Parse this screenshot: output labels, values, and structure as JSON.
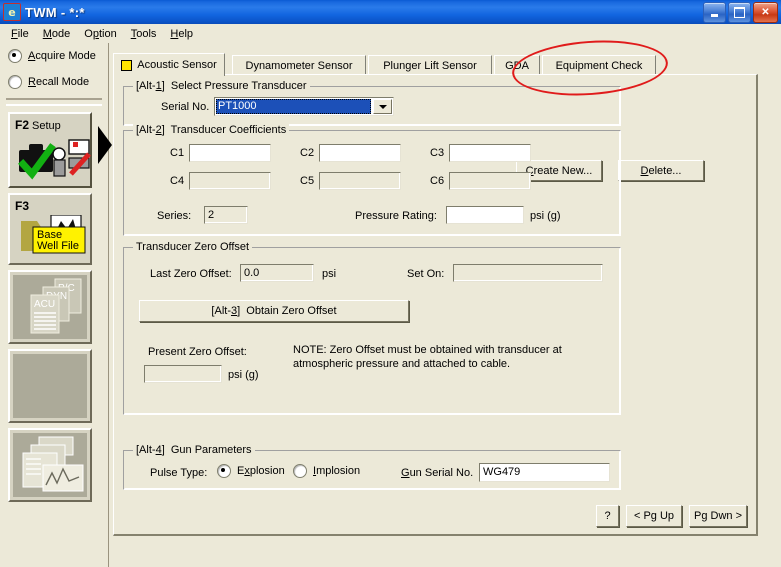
{
  "window": {
    "title": "TWM  -  *:*",
    "icon": "app-icon",
    "minimize": "_",
    "maximize": "□",
    "close": "✕"
  },
  "menubar": {
    "items": [
      {
        "label": "File",
        "accel": "F"
      },
      {
        "label": "Mode",
        "accel": "M"
      },
      {
        "label": "Option",
        "accel": "p"
      },
      {
        "label": "Tools",
        "accel": "T"
      },
      {
        "label": "Help",
        "accel": "H"
      }
    ]
  },
  "sidebar": {
    "modes": [
      {
        "label": "Acquire Mode",
        "accel": "A",
        "selected": true
      },
      {
        "label": "Recall Mode",
        "accel": "R",
        "selected": false
      }
    ],
    "buttons": [
      {
        "key": "F2",
        "label": "Setup",
        "art": "toolbox-check-icon",
        "enabled": true
      },
      {
        "key": "F3",
        "label": "Base Well File",
        "art": "yellow-folder-icon",
        "enabled": true
      },
      {
        "key": "",
        "label": "",
        "art": "document-stack-icon",
        "enabled": false,
        "doc_tags": [
          "P/C",
          "DYN",
          "ACU"
        ]
      },
      {
        "key": "",
        "label": "",
        "art": "blank-icon",
        "enabled": false
      },
      {
        "key": "",
        "label": "",
        "art": "report-chart-icon",
        "enabled": false
      }
    ]
  },
  "tabs": [
    {
      "label": "Acoustic Sensor",
      "active": true,
      "icon": "yellow-square-icon"
    },
    {
      "label": "Dynamometer Sensor",
      "active": false
    },
    {
      "label": "Plunger Lift Sensor",
      "active": false
    },
    {
      "label": "GDA",
      "active": false
    },
    {
      "label": "Equipment Check",
      "active": false,
      "annotated": true
    }
  ],
  "annotation": {
    "shape": "red-ellipse",
    "color": "#E01B1B",
    "target": "Equipment Check"
  },
  "select_transducer": {
    "group_prefix": "[Alt-",
    "group_accel": "1",
    "group_label_tail": "]  Select Pressure Transducer",
    "serial_label": "Serial No.",
    "serial_value": "PT1000",
    "create_new": "Create New...",
    "create_new_accel": "C",
    "delete": "Delete...",
    "delete_accel": "D"
  },
  "coefficients": {
    "group_prefix": "[Alt-",
    "group_accel": "2",
    "group_label_tail": "]   Transducer Coefficients",
    "fields": [
      {
        "label": "C1",
        "value": "",
        "enabled": true
      },
      {
        "label": "C2",
        "value": "",
        "enabled": true
      },
      {
        "label": "C3",
        "value": "",
        "enabled": true
      },
      {
        "label": "C4",
        "value": "",
        "enabled": false
      },
      {
        "label": "C5",
        "value": "",
        "enabled": false
      },
      {
        "label": "C6",
        "value": "",
        "enabled": false
      }
    ],
    "series_label": "Series:",
    "series_value": "2",
    "pressure_rating_label": "Pressure Rating:",
    "pressure_rating_value": "",
    "pressure_units": "psi (g)"
  },
  "zero_offset": {
    "group_label": "Transducer Zero Offset",
    "last_label": "Last Zero Offset:",
    "last_value": "0.0",
    "last_units": "psi",
    "set_on_label": "Set On:",
    "set_on_value": "",
    "obtain_prefix": "[Alt-",
    "obtain_accel": "3",
    "obtain_tail": "]  Obtain Zero Offset",
    "present_label": "Present Zero Offset:",
    "present_value": "",
    "present_units": "psi (g)",
    "note": "NOTE:  Zero Offset must be obtained with transducer at atmospheric pressure and attached to cable."
  },
  "gun_parameters": {
    "group_prefix": "[Alt-",
    "group_accel": "4",
    "group_label_tail": "]  Gun Parameters",
    "pulse_label": "Pulse Type:",
    "options": [
      {
        "label": "Explosion",
        "accel": "x",
        "selected": true
      },
      {
        "label": "Implosion",
        "accel": "I",
        "selected": false
      }
    ],
    "gun_serial_label": "Gun Serial No.",
    "gun_serial_accel": "G",
    "gun_serial_value": "WG479"
  },
  "footer": {
    "help": "?",
    "pg_up": "< Pg Up",
    "pg_dwn": "Pg Dwn >"
  }
}
